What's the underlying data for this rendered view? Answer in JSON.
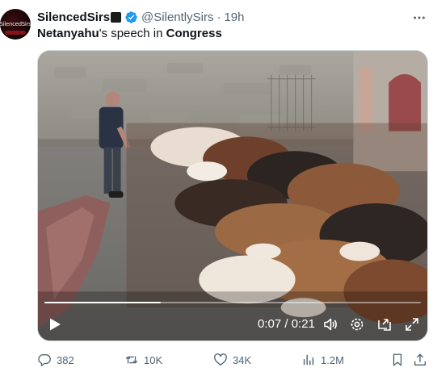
{
  "author": {
    "avatar_text": "SilencedSirs",
    "display_name": "SilencedSirs",
    "handle": "@SilentlySirs",
    "separator": "·",
    "timestamp": "19h",
    "verified": true,
    "badge_color": "#1d9bf0"
  },
  "post": {
    "text_part1": "Netanyahu",
    "text_part2": "'s speech in ",
    "text_part3": "Congress"
  },
  "video": {
    "current_time": "0:07",
    "time_separator": " / ",
    "duration": "0:21",
    "progress_fraction": 0.31
  },
  "actions": {
    "replies": "382",
    "reposts": "10K",
    "likes": "34K",
    "views": "1.2M"
  },
  "icons": {
    "more": "more-horizontal-icon",
    "play": "play-icon",
    "volume": "volume-icon",
    "settings": "settings-icon",
    "captions": "captions-icon",
    "fullscreen": "fullscreen-icon",
    "reply": "reply-icon",
    "repost": "repost-icon",
    "like": "heart-icon",
    "views": "views-chart-icon",
    "bookmark": "bookmark-icon",
    "share": "share-icon"
  }
}
